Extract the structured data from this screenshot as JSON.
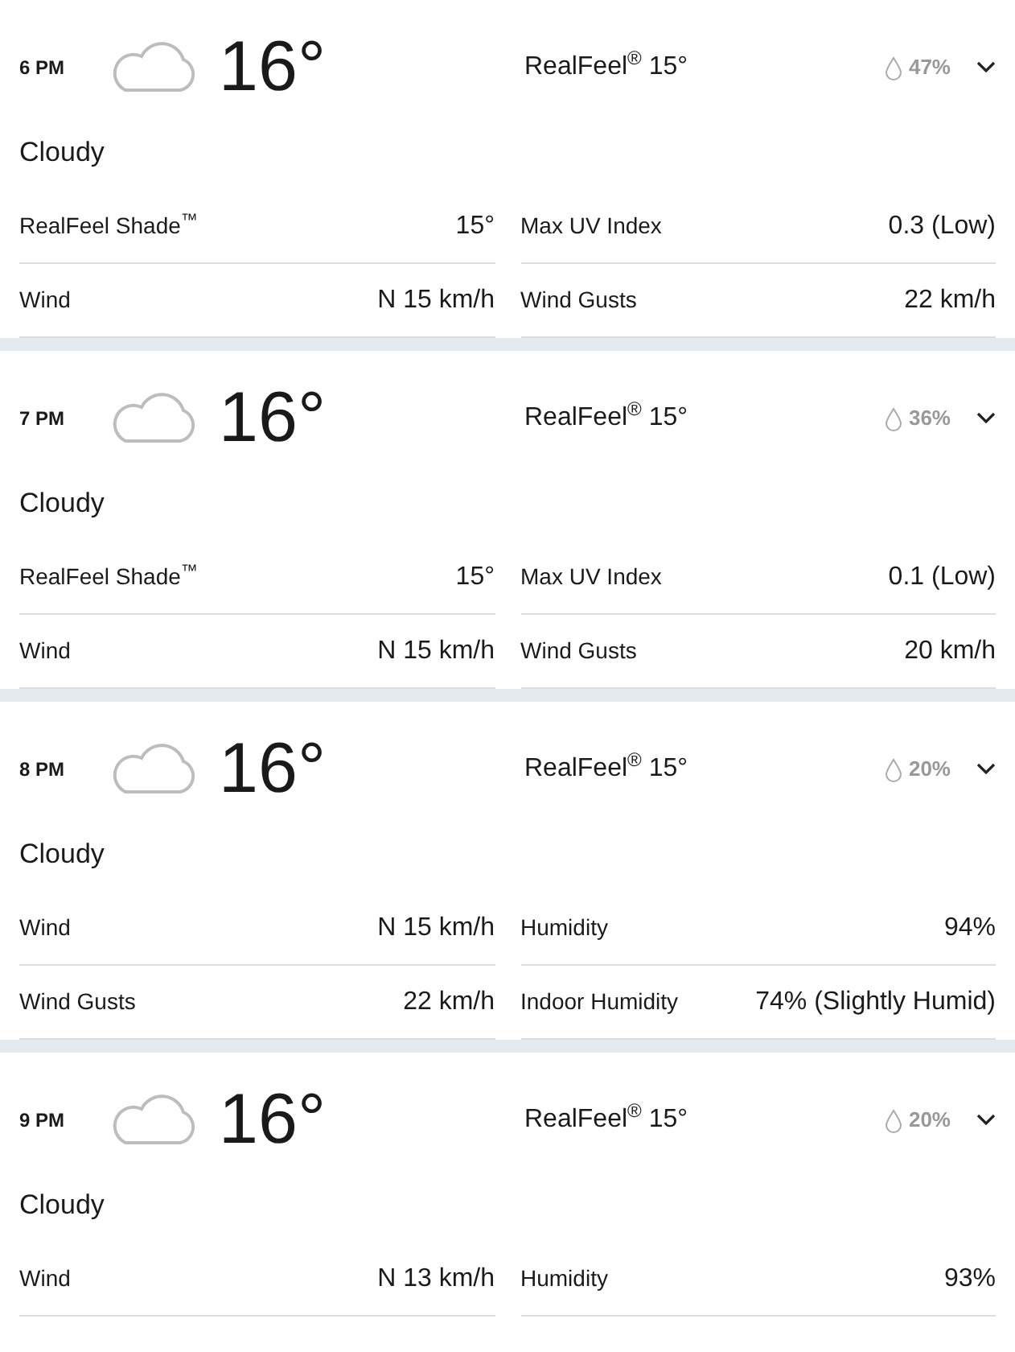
{
  "hours": [
    {
      "time": "6 PM",
      "temperature": "16°",
      "realfeel": "RealFeel$^{®}$ 15°",
      "precipitation": "47%",
      "condition": "Cloudy",
      "details": [
        {
          "label": "RealFeel Shade$^{™}$",
          "value": "15°"
        },
        {
          "label": "Max UV Index",
          "value": "0.3 (Low)"
        },
        {
          "label": "Wind",
          "value": "N 15 km/h"
        },
        {
          "label": "Wind Gusts",
          "value": "22 km/h"
        }
      ]
    },
    {
      "time": "7 PM",
      "temperature": "16°",
      "realfeel": "RealFeel$^{®}$ 15°",
      "precipitation": "36%",
      "condition": "Cloudy",
      "details": [
        {
          "label": "RealFeel Shade$^{™}$",
          "value": "15°"
        },
        {
          "label": "Max UV Index",
          "value": "0.1 (Low)"
        },
        {
          "label": "Wind",
          "value": "N 15 km/h"
        },
        {
          "label": "Wind Gusts",
          "value": "20 km/h"
        }
      ]
    },
    {
      "time": "8 PM",
      "temperature": "16°",
      "realfeel": "RealFeel$^{®}$ 15°",
      "precipitation": "20%",
      "condition": "Cloudy",
      "details": [
        {
          "label": "Wind",
          "value": "N 15 km/h"
        },
        {
          "label": "Humidity",
          "value": "94%"
        },
        {
          "label": "Wind Gusts",
          "value": "22 km/h"
        },
        {
          "label": "Indoor Humidity",
          "value": "74% (Slightly Humid)"
        }
      ]
    },
    {
      "time": "9 PM",
      "temperature": "16°",
      "realfeel": "RealFeel$^{®}$ 15°",
      "precipitation": "20%",
      "condition": "Cloudy",
      "details": [
        {
          "label": "Wind",
          "value": "N 13 km/h"
        },
        {
          "label": "Humidity",
          "value": "93%"
        }
      ]
    }
  ]
}
